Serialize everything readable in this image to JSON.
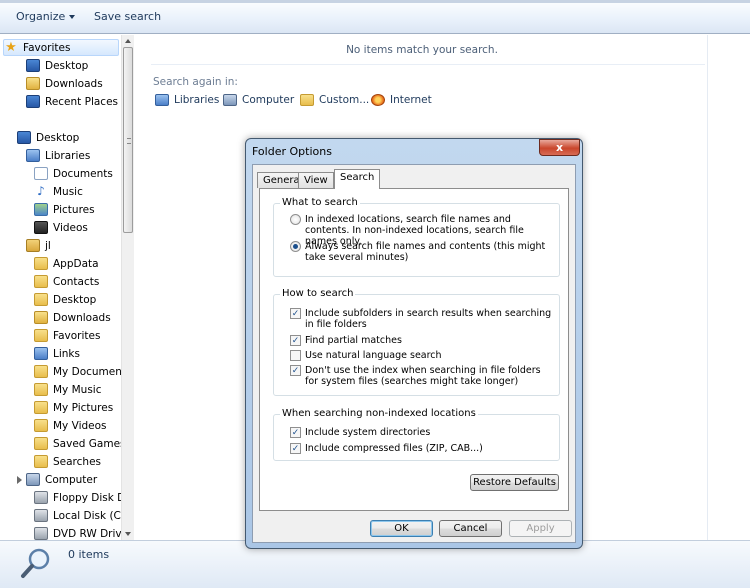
{
  "toolbar": {
    "organize_label": "Organize",
    "save_search_label": "Save search"
  },
  "nav": {
    "items": [
      {
        "label": "Favorites",
        "icon": "star-icon"
      },
      {
        "label": "Desktop",
        "icon": "desktop-icon"
      },
      {
        "label": "Downloads",
        "icon": "downloads-icon"
      },
      {
        "label": "Recent Places",
        "icon": "recent-places-icon"
      },
      {
        "label": "Desktop",
        "icon": "desktop-icon"
      },
      {
        "label": "Libraries",
        "icon": "libraries-icon"
      },
      {
        "label": "Documents",
        "icon": "documents-icon"
      },
      {
        "label": "Music",
        "icon": "music-icon"
      },
      {
        "label": "Pictures",
        "icon": "pictures-icon"
      },
      {
        "label": "Videos",
        "icon": "videos-icon"
      },
      {
        "label": "jl",
        "icon": "user-folder-icon"
      },
      {
        "label": "AppData",
        "icon": "folder-icon"
      },
      {
        "label": "Contacts",
        "icon": "contacts-icon"
      },
      {
        "label": "Desktop",
        "icon": "desktop-icon"
      },
      {
        "label": "Downloads",
        "icon": "downloads-icon"
      },
      {
        "label": "Favorites",
        "icon": "favorites-icon"
      },
      {
        "label": "Links",
        "icon": "links-icon"
      },
      {
        "label": "My Documents",
        "icon": "documents-icon"
      },
      {
        "label": "My Music",
        "icon": "music-icon"
      },
      {
        "label": "My Pictures",
        "icon": "pictures-icon"
      },
      {
        "label": "My Videos",
        "icon": "videos-icon"
      },
      {
        "label": "Saved Games",
        "icon": "saved-games-icon"
      },
      {
        "label": "Searches",
        "icon": "searches-icon"
      },
      {
        "label": "Computer",
        "icon": "computer-icon"
      },
      {
        "label": "Floppy Disk Dri",
        "icon": "floppy-icon"
      },
      {
        "label": "Local Disk (C:)",
        "icon": "disk-icon"
      },
      {
        "label": "DVD RW Drive",
        "icon": "dvd-icon"
      }
    ]
  },
  "content": {
    "no_items": "No items match your search.",
    "search_again": "Search again in:",
    "locations": [
      {
        "label": "Libraries",
        "icon": "libraries-icon"
      },
      {
        "label": "Computer",
        "icon": "computer-icon"
      },
      {
        "label": "Custom...",
        "icon": "custom-folder-icon"
      },
      {
        "label": "Internet",
        "icon": "internet-icon"
      }
    ]
  },
  "status": {
    "count": "0 items"
  },
  "dialog": {
    "title": "Folder Options",
    "close": "x",
    "tabs": [
      "General",
      "View",
      "Search"
    ],
    "active_tab": "Search",
    "what_to_search": {
      "title": "What to search",
      "options": [
        {
          "label": "In indexed locations, search file names and contents. In non-indexed locations, search file names only.",
          "selected": false
        },
        {
          "label": "Always search file names and contents (this might take several minutes)",
          "selected": true
        }
      ]
    },
    "how_to_search": {
      "title": "How to search",
      "options": [
        {
          "label": "Include subfolders in search results when searching in file folders",
          "checked": true
        },
        {
          "label": "Find partial matches",
          "checked": true
        },
        {
          "label": "Use natural language search",
          "checked": false
        },
        {
          "label": "Don't use the index when searching in file folders for system files (searches might take longer)",
          "checked": true
        }
      ]
    },
    "non_indexed": {
      "title": "When searching non-indexed locations",
      "options": [
        {
          "label": "Include system directories",
          "checked": true
        },
        {
          "label": "Include compressed files (ZIP, CAB...)",
          "checked": true
        }
      ]
    },
    "restore_label": "Restore Defaults",
    "ok_label": "OK",
    "cancel_label": "Cancel",
    "apply_label": "Apply"
  }
}
